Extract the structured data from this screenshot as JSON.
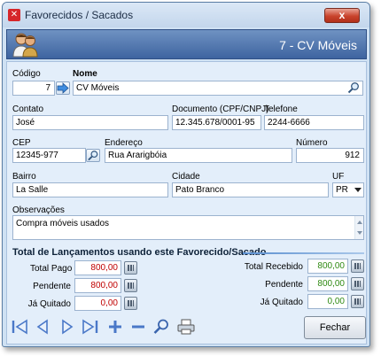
{
  "window": {
    "title": "Favorecidos / Sacados",
    "close_label": "x"
  },
  "header": {
    "title": "7 - CV Móveis"
  },
  "form": {
    "codigo": {
      "label": "Código",
      "value": "7"
    },
    "nome": {
      "label": "Nome",
      "value": "CV Móveis"
    },
    "contato": {
      "label": "Contato",
      "value": "José"
    },
    "documento": {
      "label": "Documento (CPF/CNPJ)",
      "value": "12.345.678/0001-95"
    },
    "telefone": {
      "label": "Telefone",
      "value": "2244-6666"
    },
    "cep": {
      "label": "CEP",
      "value": "12345-977"
    },
    "endereco": {
      "label": "Endereço",
      "value": "Rua Ararigbóia"
    },
    "numero": {
      "label": "Número",
      "value": "912"
    },
    "bairro": {
      "label": "Bairro",
      "value": "La Salle"
    },
    "cidade": {
      "label": "Cidade",
      "value": "Pato Branco"
    },
    "uf": {
      "label": "UF",
      "value": "PR"
    },
    "observacoes": {
      "label": "Observações",
      "value": "Compra móveis usados"
    }
  },
  "totals": {
    "title": "Total de Lançamentos usando este Favorecido/Sacado",
    "pago": {
      "label": "Total Pago",
      "value": "800,00"
    },
    "pendente_left": {
      "label": "Pendente",
      "value": "800,00"
    },
    "quitado_left": {
      "label": "Já Quitado",
      "value": "0,00"
    },
    "recebido": {
      "label": "Total Recebido",
      "value": "800,00"
    },
    "pendente_right": {
      "label": "Pendente",
      "value": "800,00"
    },
    "quitado_right": {
      "label": "Já Quitado",
      "value": "0,00"
    }
  },
  "toolbar": {
    "icons": [
      "first-icon",
      "previous-icon",
      "next-icon",
      "last-icon",
      "add-icon",
      "remove-icon",
      "search-icon",
      "print-icon"
    ],
    "close_button_label": "Fechar"
  },
  "colors": {
    "pago_value": "#c00000",
    "recebido_value": "#2f8a12",
    "header_band": "#3e64a0"
  }
}
